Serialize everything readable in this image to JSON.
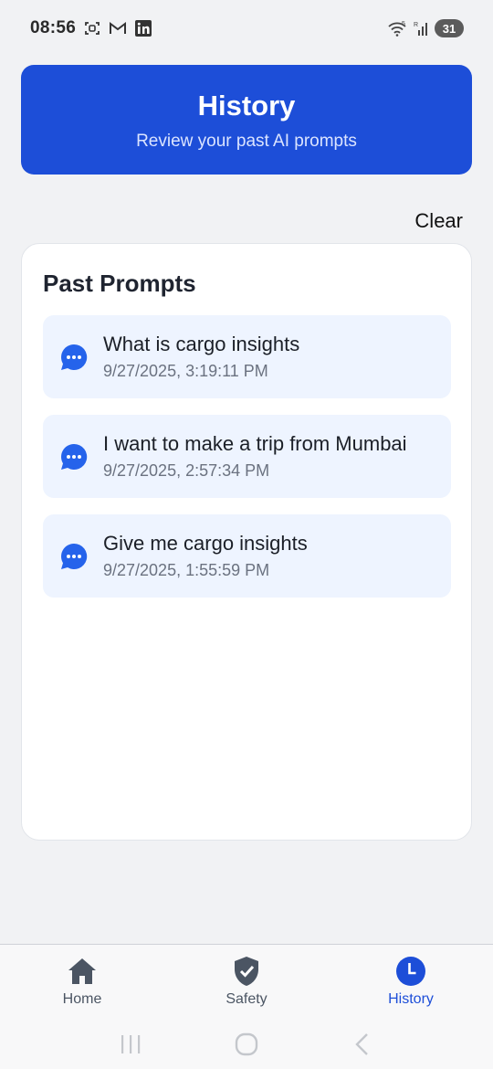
{
  "status_bar": {
    "time": "08:56",
    "battery": "31",
    "network_badge": "5",
    "signal_badge": "R"
  },
  "header": {
    "title": "History",
    "subtitle": "Review your past AI prompts"
  },
  "actions": {
    "clear_label": "Clear"
  },
  "panel": {
    "title": "Past Prompts",
    "prompts": [
      {
        "text": "What is cargo insights",
        "time": "9/27/2025, 3:19:11 PM"
      },
      {
        "text": "I want to make a trip from Mumbai",
        "time": "9/27/2025, 2:57:34 PM"
      },
      {
        "text": "Give me cargo insights",
        "time": "9/27/2025, 1:55:59 PM"
      }
    ]
  },
  "bottom_nav": {
    "items": [
      {
        "label": "Home",
        "icon": "home-icon"
      },
      {
        "label": "Safety",
        "icon": "shield-check-icon"
      },
      {
        "label": "History",
        "icon": "clock-icon",
        "active": true
      }
    ]
  },
  "colors": {
    "accent": "#1d4ed8",
    "prompt_bg": "#eef4ff",
    "page_bg": "#f1f2f4"
  }
}
